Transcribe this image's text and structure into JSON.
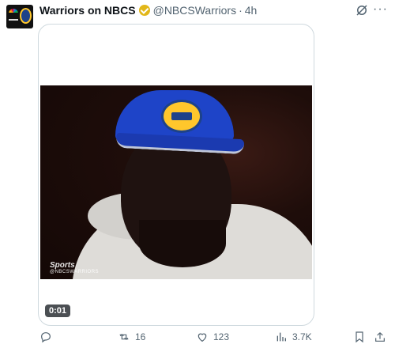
{
  "author": {
    "display_name": "Warriors on NBCS",
    "handle": "@NBCSWarriors",
    "separator": "·",
    "time": "4h"
  },
  "header_icons": {
    "grok": "grok-icon",
    "more": "more-icon",
    "more_glyph": "···"
  },
  "media": {
    "watermark": "Sports",
    "watermark_sub": "@NBCSWARRIORS",
    "duration": "0:01"
  },
  "actions": {
    "reply_count": "",
    "retweet_count": "16",
    "like_count": "123",
    "views_count": "3.7K"
  },
  "colors": {
    "text": "#0f1419",
    "muted": "#536471",
    "verified": "#e2b719",
    "cap_blue": "#1e44c8",
    "border": "#cfd9de"
  }
}
